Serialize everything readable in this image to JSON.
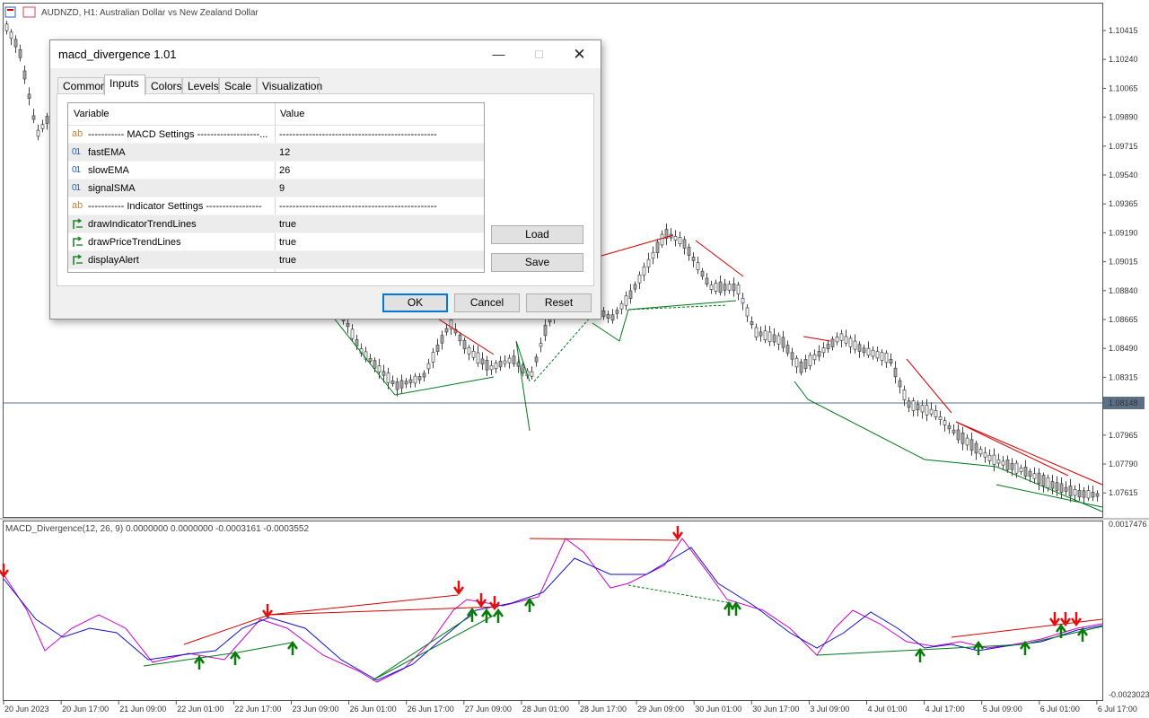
{
  "chart": {
    "title": "AUDNZD, H1:  Australian Dollar vs New Zealand Dollar",
    "price_labels": [
      "1.10415",
      "1.10240",
      "1.10065",
      "1.09890",
      "1.09715",
      "1.09540",
      "1.09365",
      "1.09190",
      "1.09015",
      "1.08840",
      "1.08665",
      "1.08490",
      "1.08315",
      "1.08148",
      "1.07965",
      "1.07790",
      "1.07615"
    ],
    "current_price": "1.08148",
    "indicator_title": "MACD_Divergence(12, 26, 9) 0.0000000 0.0000000 -0.0003161 -0.0003552",
    "indicator_max": "0.0017476",
    "indicator_min": "-0.0023023",
    "time_labels": [
      "20 Jun 2023",
      "20 Jun 17:00",
      "21 Jun 09:00",
      "22 Jun 01:00",
      "22 Jun 17:00",
      "23 Jun 09:00",
      "26 Jun 01:00",
      "26 Jun 17:00",
      "27 Jun 09:00",
      "28 Jun 01:00",
      "28 Jun 17:00",
      "29 Jun 09:00",
      "30 Jun 01:00",
      "30 Jun 17:00",
      "3 Jul 09:00",
      "4 Jul 01:00",
      "4 Jul 17:00",
      "5 Jul 09:00",
      "6 Jul 01:00",
      "6 Jul 17:00"
    ],
    "colors": {
      "bull": "#ffffff",
      "bear": "#a9a9a9",
      "line_up": "#d40000",
      "line_down": "#00781a",
      "macd": "#cc00cc",
      "signal": "#1010c8"
    }
  },
  "dialog": {
    "title": "macd_divergence 1.01",
    "min_icon": "minimize-icon",
    "max_icon": "maximize-icon",
    "close_icon": "close-icon",
    "tabs": [
      "Common",
      "Inputs",
      "Colors",
      "Levels",
      "Scale",
      "Visualization"
    ],
    "active_tab": "Inputs",
    "grid": {
      "col_variable": "Variable",
      "col_value": "Value",
      "rows": [
        {
          "type": "ab",
          "name": "----------- MACD Settings -------------------...",
          "value": "------------------------------------------------"
        },
        {
          "type": "01",
          "name": "fastEMA",
          "value": "12"
        },
        {
          "type": "01",
          "name": "slowEMA",
          "value": "26"
        },
        {
          "type": "01",
          "name": "signalSMA",
          "value": "9"
        },
        {
          "type": "ab",
          "name": "----------- Indicator Settings -----------------",
          "value": "------------------------------------------------"
        },
        {
          "type": "bool",
          "name": "drawIndicatorTrendLines",
          "value": "true"
        },
        {
          "type": "bool",
          "name": "drawPriceTrendLines",
          "value": "true"
        },
        {
          "type": "bool",
          "name": "displayAlert",
          "value": "true"
        }
      ]
    },
    "load_label": "Load",
    "save_label": "Save",
    "ok_label": "OK",
    "cancel_label": "Cancel",
    "reset_label": "Reset"
  }
}
